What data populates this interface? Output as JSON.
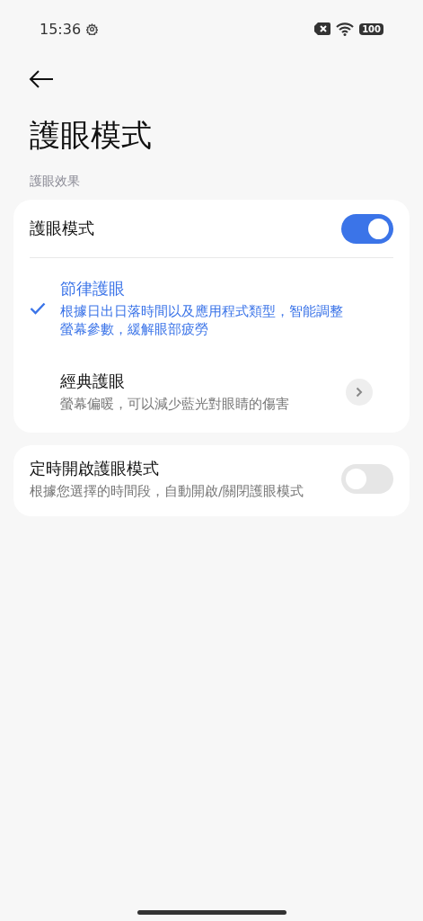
{
  "status_bar": {
    "time": "15:36",
    "battery": "100"
  },
  "title": "護眼模式",
  "section_label": "護眼效果",
  "main_card": {
    "toggle": {
      "label": "護眼模式",
      "on": true
    },
    "options": [
      {
        "title": "節律護眼",
        "description": "根據日出日落時間以及應用程式類型，智能調整螢幕參數，緩解眼部疲勞",
        "selected": true,
        "has_detail": false
      },
      {
        "title": "經典護眼",
        "description": "螢幕偏暖，可以減少藍光對眼睛的傷害",
        "selected": false,
        "has_detail": true
      }
    ]
  },
  "schedule_card": {
    "title": "定時開啟護眼模式",
    "description": "根據您選擇的時間段，自動開啟/關閉護眼模式",
    "on": false
  }
}
